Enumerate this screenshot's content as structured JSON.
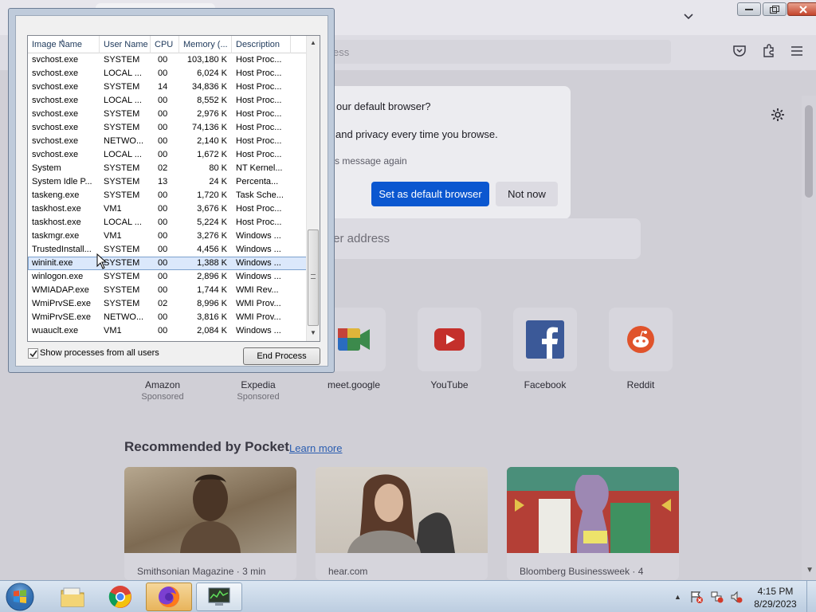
{
  "firefox": {
    "urlbar_placeholder": "ess",
    "default_dialog": {
      "question": "our default browser?",
      "privacy_text": "and privacy every time you browse.",
      "dont_show": "s message again",
      "primary_button": "Set as default browser",
      "secondary_button": "Not now"
    },
    "search_placeholder": "ter address",
    "shortcuts": [
      {
        "name": "Amazon",
        "sponsored": "Sponsored"
      },
      {
        "name": "Expedia",
        "sponsored": "Sponsored"
      },
      {
        "name": "meet.google",
        "sponsored": ""
      },
      {
        "name": "YouTube",
        "sponsored": ""
      },
      {
        "name": "Facebook",
        "sponsored": ""
      },
      {
        "name": "Reddit",
        "sponsored": ""
      }
    ],
    "pocket": {
      "title": "Recommended by Pocket",
      "learn_more": "Learn more",
      "cards": [
        {
          "source": "Smithsonian Magazine · 3 min"
        },
        {
          "source": "hear.com"
        },
        {
          "source": "Bloomberg Businessweek · 4"
        }
      ]
    }
  },
  "task_manager": {
    "columns": [
      "Image Name",
      "User Name",
      "CPU",
      "Memory (...",
      "Description"
    ],
    "rows": [
      {
        "name": "svchost.exe",
        "user": "SYSTEM",
        "cpu": "00",
        "mem": "103,180 K",
        "desc": "Host Proc..."
      },
      {
        "name": "svchost.exe",
        "user": "LOCAL ...",
        "cpu": "00",
        "mem": "6,024 K",
        "desc": "Host Proc..."
      },
      {
        "name": "svchost.exe",
        "user": "SYSTEM",
        "cpu": "14",
        "mem": "34,836 K",
        "desc": "Host Proc..."
      },
      {
        "name": "svchost.exe",
        "user": "LOCAL ...",
        "cpu": "00",
        "mem": "8,552 K",
        "desc": "Host Proc..."
      },
      {
        "name": "svchost.exe",
        "user": "SYSTEM",
        "cpu": "00",
        "mem": "2,976 K",
        "desc": "Host Proc..."
      },
      {
        "name": "svchost.exe",
        "user": "SYSTEM",
        "cpu": "00",
        "mem": "74,136 K",
        "desc": "Host Proc..."
      },
      {
        "name": "svchost.exe",
        "user": "NETWO...",
        "cpu": "00",
        "mem": "2,140 K",
        "desc": "Host Proc..."
      },
      {
        "name": "svchost.exe",
        "user": "LOCAL ...",
        "cpu": "00",
        "mem": "1,672 K",
        "desc": "Host Proc..."
      },
      {
        "name": "System",
        "user": "SYSTEM",
        "cpu": "02",
        "mem": "80 K",
        "desc": "NT Kernel..."
      },
      {
        "name": "System Idle P...",
        "user": "SYSTEM",
        "cpu": "13",
        "mem": "24 K",
        "desc": "Percenta..."
      },
      {
        "name": "taskeng.exe",
        "user": "SYSTEM",
        "cpu": "00",
        "mem": "1,720 K",
        "desc": "Task Sche..."
      },
      {
        "name": "taskhost.exe",
        "user": "VM1",
        "cpu": "00",
        "mem": "3,676 K",
        "desc": "Host Proc..."
      },
      {
        "name": "taskhost.exe",
        "user": "LOCAL ...",
        "cpu": "00",
        "mem": "5,224 K",
        "desc": "Host Proc..."
      },
      {
        "name": "taskmgr.exe",
        "user": "VM1",
        "cpu": "00",
        "mem": "3,276 K",
        "desc": "Windows ..."
      },
      {
        "name": "TrustedInstall...",
        "user": "SYSTEM",
        "cpu": "00",
        "mem": "4,456 K",
        "desc": "Windows ..."
      },
      {
        "name": "wininit.exe",
        "user": "SYSTEM",
        "cpu": "00",
        "mem": "1,388 K",
        "desc": "Windows ...",
        "selected": true
      },
      {
        "name": "winlogon.exe",
        "user": "SYSTEM",
        "cpu": "00",
        "mem": "2,896 K",
        "desc": "Windows ..."
      },
      {
        "name": "WMIADAP.exe",
        "user": "SYSTEM",
        "cpu": "00",
        "mem": "1,744 K",
        "desc": "WMI Rev..."
      },
      {
        "name": "WmiPrvSE.exe",
        "user": "SYSTEM",
        "cpu": "02",
        "mem": "8,996 K",
        "desc": "WMI Prov..."
      },
      {
        "name": "WmiPrvSE.exe",
        "user": "NETWO...",
        "cpu": "00",
        "mem": "3,816 K",
        "desc": "WMI Prov..."
      },
      {
        "name": "wuauclt.exe",
        "user": "VM1",
        "cpu": "00",
        "mem": "2,084 K",
        "desc": "Windows ..."
      }
    ],
    "show_all_label": "Show processes from all users",
    "show_all_checked": true,
    "end_process_label": "End Process"
  },
  "taskbar": {
    "time": "4:15 PM",
    "date": "8/29/2023"
  }
}
